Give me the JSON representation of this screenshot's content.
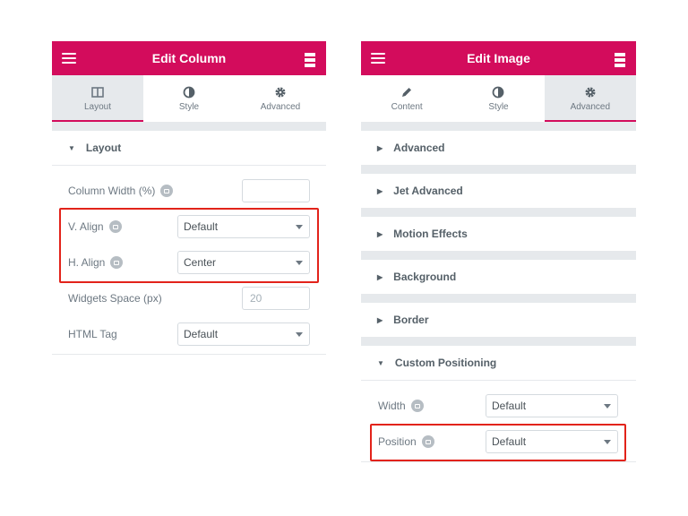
{
  "left_panel": {
    "title": "Edit Column",
    "tabs": [
      {
        "label": "Layout",
        "active": true
      },
      {
        "label": "Style",
        "active": false
      },
      {
        "label": "Advanced",
        "active": false
      }
    ],
    "section": "Layout",
    "controls": {
      "column_width": {
        "label": "Column Width (%)",
        "value": ""
      },
      "v_align": {
        "label": "V. Align",
        "value": "Default"
      },
      "h_align": {
        "label": "H. Align",
        "value": "Center"
      },
      "widgets_space": {
        "label": "Widgets Space (px)",
        "placeholder": "20"
      },
      "html_tag": {
        "label": "HTML Tag",
        "value": "Default"
      }
    }
  },
  "right_panel": {
    "title": "Edit Image",
    "tabs": [
      {
        "label": "Content",
        "active": false
      },
      {
        "label": "Style",
        "active": false
      },
      {
        "label": "Advanced",
        "active": true
      }
    ],
    "sections": [
      "Advanced",
      "Jet Advanced",
      "Motion Effects",
      "Background",
      "Border",
      "Custom Positioning"
    ],
    "controls": {
      "width": {
        "label": "Width",
        "value": "Default"
      },
      "position": {
        "label": "Position",
        "value": "Default"
      }
    }
  },
  "colors": {
    "accent": "#d30c5c",
    "highlight": "#e2231a"
  },
  "icons": [
    "menu-icon",
    "apps-grid-icon",
    "columns-icon",
    "contrast-icon",
    "gear-icon",
    "pencil-icon",
    "caret-right-icon",
    "caret-down-icon",
    "responsive-icon"
  ]
}
